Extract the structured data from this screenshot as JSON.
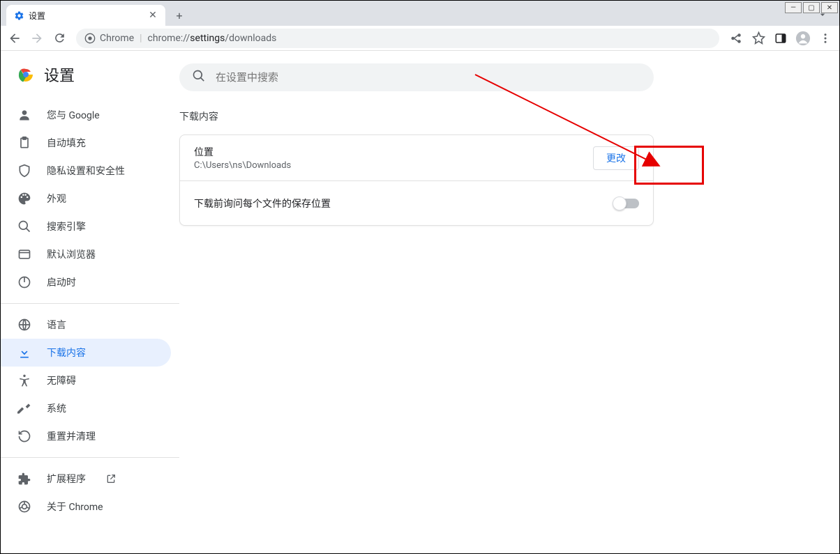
{
  "tab": {
    "title": "设置"
  },
  "address": {
    "prefix": "Chrome",
    "url_plain": "chrome://",
    "url_bold": "settings",
    "url_tail": "/downloads"
  },
  "header": {
    "title": "设置"
  },
  "search": {
    "placeholder": "在设置中搜索"
  },
  "sidebar": {
    "group1": [
      {
        "label": "您与 Google"
      },
      {
        "label": "自动填充"
      },
      {
        "label": "隐私设置和安全性"
      },
      {
        "label": "外观"
      },
      {
        "label": "搜索引擎"
      },
      {
        "label": "默认浏览器"
      },
      {
        "label": "启动时"
      }
    ],
    "group2": [
      {
        "label": "语言"
      },
      {
        "label": "下载内容"
      },
      {
        "label": "无障碍"
      },
      {
        "label": "系统"
      },
      {
        "label": "重置并清理"
      }
    ],
    "group3": [
      {
        "label": "扩展程序"
      },
      {
        "label": "关于 Chrome"
      }
    ]
  },
  "section": {
    "title": "下载内容",
    "location_label": "位置",
    "location_path": "C:\\Users\\ns\\Downloads",
    "change_btn": "更改",
    "ask_label": "下载前询问每个文件的保存位置"
  }
}
